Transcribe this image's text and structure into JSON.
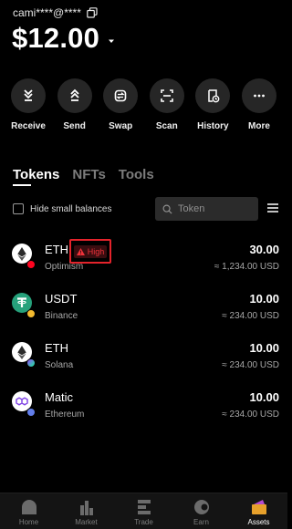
{
  "account": {
    "name": "cami****@****",
    "copy_icon": "copy-icon"
  },
  "balance": {
    "value": "$12.00",
    "caret_icon": "caret-down-icon"
  },
  "actions": [
    {
      "label": "Receive",
      "icon": "receive-icon"
    },
    {
      "label": "Send",
      "icon": "send-icon"
    },
    {
      "label": "Swap",
      "icon": "swap-icon"
    },
    {
      "label": "Scan",
      "icon": "scan-icon"
    },
    {
      "label": "History",
      "icon": "history-icon"
    },
    {
      "label": "More",
      "icon": "more-icon"
    }
  ],
  "tabs": [
    {
      "label": "Tokens",
      "active": true
    },
    {
      "label": "NFTs",
      "active": false
    },
    {
      "label": "Tools",
      "active": false
    }
  ],
  "filter": {
    "hide_small_label": "Hide small balances",
    "hide_small_checked": false,
    "search_placeholder": "Token"
  },
  "tokens": [
    {
      "symbol": "ETH",
      "chain": "Optimism",
      "amount": "30.00",
      "usd": "≈ 1,234.00 USD",
      "risk": "High",
      "icon_color": "#ffffff",
      "badge_color": "#ff0420"
    },
    {
      "symbol": "USDT",
      "chain": "Binance",
      "amount": "10.00",
      "usd": "≈ 234.00 USD",
      "icon_color": "#26a17b",
      "badge_color": "#f3ba2f"
    },
    {
      "symbol": "ETH",
      "chain": "Solana",
      "amount": "10.00",
      "usd": "≈ 234.00 USD",
      "icon_color": "#ffffff",
      "badge_color": "#9945ff"
    },
    {
      "symbol": "Matic",
      "chain": "Ethereum",
      "amount": "10.00",
      "usd": "≈ 234.00 USD",
      "icon_color": "#ffffff",
      "badge_color": "#627eea"
    }
  ],
  "bottom_nav": [
    {
      "label": "Home",
      "icon": "home-icon",
      "active": false
    },
    {
      "label": "Market",
      "icon": "market-icon",
      "active": false
    },
    {
      "label": "Trade",
      "icon": "trade-icon",
      "active": false
    },
    {
      "label": "Earn",
      "icon": "earn-icon",
      "active": false
    },
    {
      "label": "Assets",
      "icon": "assets-icon",
      "active": true
    }
  ],
  "colors": {
    "background": "#000000",
    "accent": "#ffffff",
    "risk": "#e4232b",
    "assets_active": "#e6a02b"
  }
}
